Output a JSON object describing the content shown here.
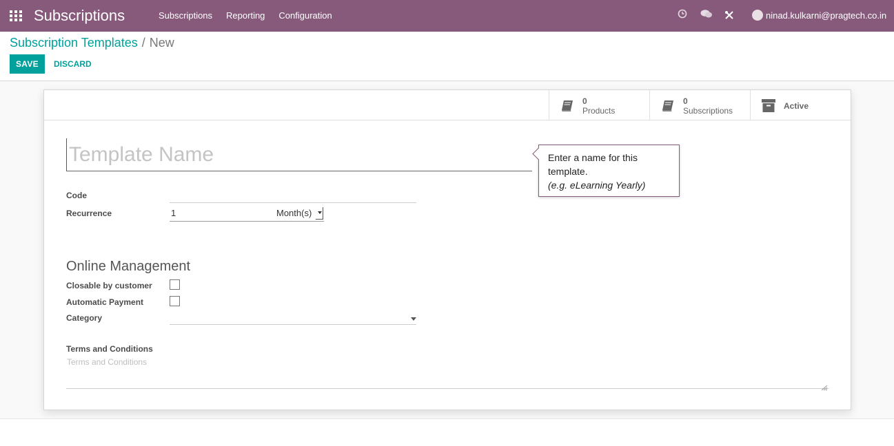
{
  "navbar": {
    "app_title": "Subscriptions",
    "menu": [
      "Subscriptions",
      "Reporting",
      "Configuration"
    ],
    "user_email": "ninad.kulkarni@pragtech.co.in",
    "color": "#875a7b"
  },
  "breadcrumb": {
    "parent": "Subscription Templates",
    "separator": "/",
    "current": "New"
  },
  "actions": {
    "save_label": "SAVE",
    "discard_label": "DISCARD"
  },
  "smart_buttons": {
    "products_count": "0",
    "products_label": "Products",
    "subscriptions_count": "0",
    "subscriptions_label": "Subscriptions",
    "active_label": "Active"
  },
  "form": {
    "name_placeholder": "Template Name",
    "tooltip_line1": "Enter a name for this template.",
    "tooltip_example": "(e.g. eLearning Yearly)",
    "code_label": "Code",
    "code_value": "",
    "recurrence_label": "Recurrence",
    "recurrence_value": "1",
    "recurrence_unit": "Month(s)",
    "section_online": "Online Management",
    "closable_label": "Closable by customer",
    "closable_checked": false,
    "automatic_payment_label": "Automatic Payment",
    "automatic_payment_checked": false,
    "category_label": "Category",
    "category_value": "",
    "terms_label": "Terms and Conditions",
    "terms_placeholder": "Terms and Conditions"
  },
  "accent_color": "#00a09d"
}
